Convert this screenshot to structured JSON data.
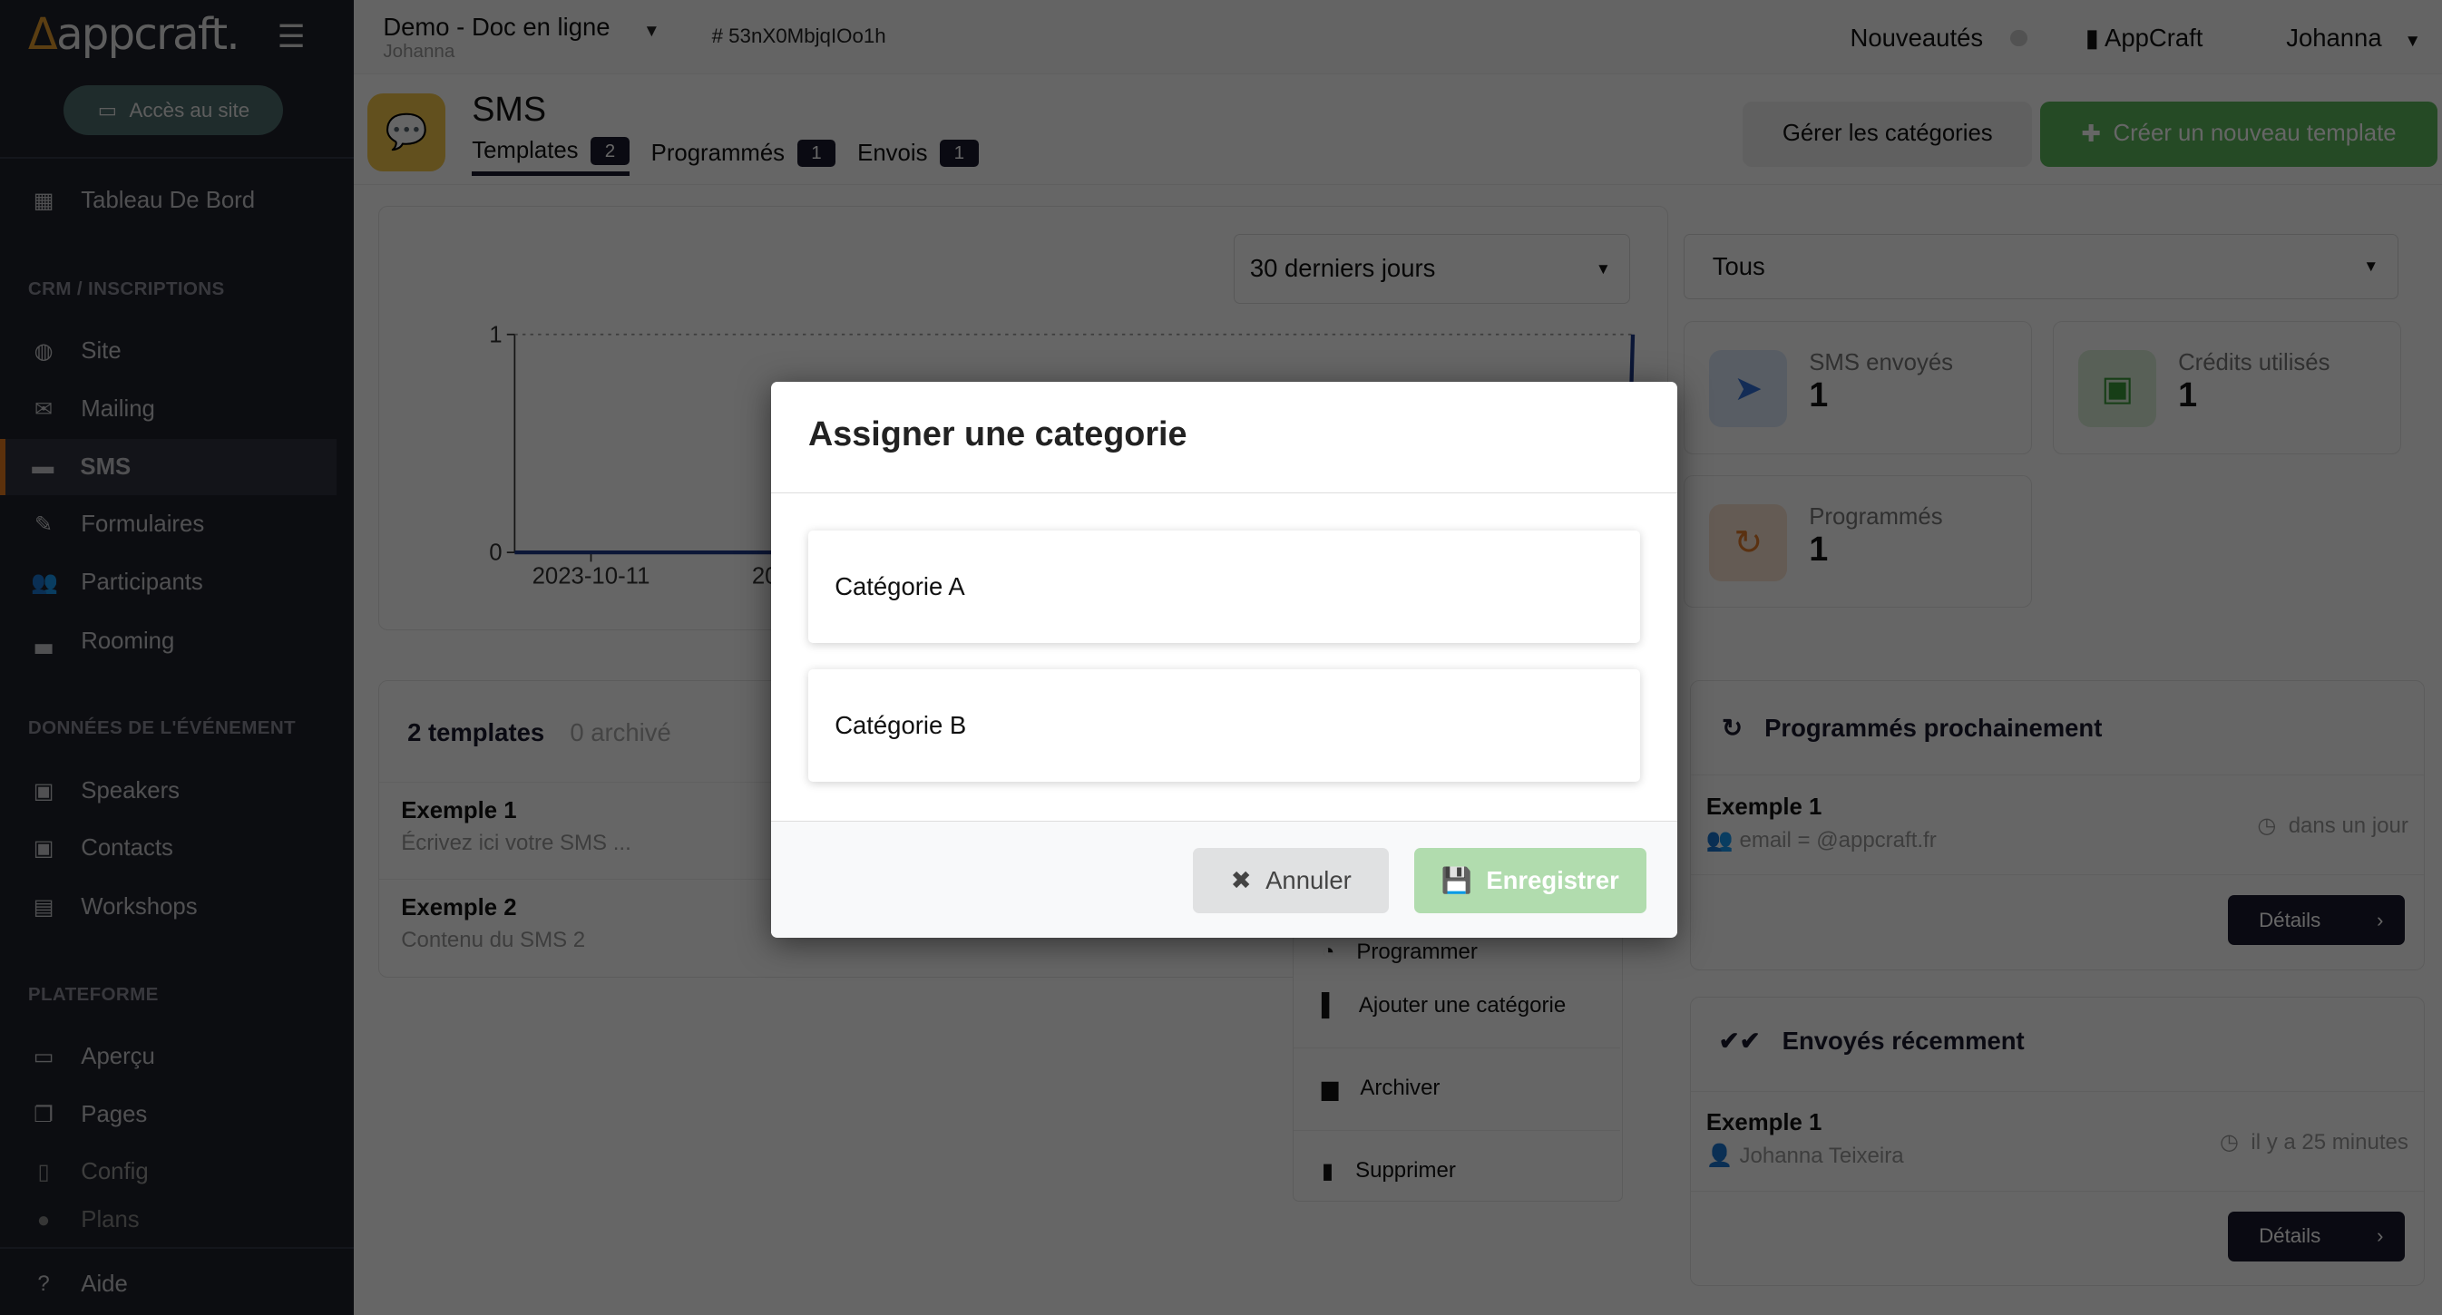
{
  "sidebar": {
    "logo": "appcraft.",
    "site_button": "Accès au site",
    "dashboard": "Tableau De Bord",
    "sections": [
      {
        "title": "CRM / INSCRIPTIONS",
        "items": [
          "Site",
          "Mailing",
          "SMS",
          "Formulaires",
          "Participants",
          "Rooming"
        ]
      },
      {
        "title": "DONNÉES DE L'ÉVÉNEMENT",
        "items": [
          "Speakers",
          "Contacts",
          "Workshops"
        ]
      },
      {
        "title": "PLATEFORME",
        "items": [
          "Aperçu",
          "Pages",
          "Config",
          "Plans"
        ]
      }
    ],
    "help": "Aide",
    "active": "SMS",
    "accent": "#e67a1f"
  },
  "topbar": {
    "project": "Demo - Doc en ligne",
    "owner": "Johanna",
    "hash": "# 53nX0MbjqIOo1h",
    "news": "Nouveautés",
    "org": "AppCraft",
    "user": "Johanna"
  },
  "page": {
    "title": "SMS",
    "tabs": [
      {
        "label": "Templates",
        "count": "2"
      },
      {
        "label": "Programmés",
        "count": "1"
      },
      {
        "label": "Envois",
        "count": "1"
      }
    ],
    "manage_categories": "Gérer les catégories",
    "create_template": "Créer un nouveau template"
  },
  "chart_filter": "30 derniers jours",
  "chart_data": {
    "type": "line",
    "x": [
      "2023-10-11",
      "…",
      "latest"
    ],
    "x_tick_labels": [
      "2023-10-11",
      "2023"
    ],
    "y_ticks": [
      "0",
      "1"
    ],
    "ylim": [
      0,
      1
    ],
    "series": [
      {
        "values": [
          0,
          0,
          1
        ]
      }
    ],
    "color": "#1e3a8a"
  },
  "type_filter": "Tous",
  "stats": [
    {
      "label": "SMS envoyés",
      "value": "1",
      "color": "#2f6fd6"
    },
    {
      "label": "Crédits utilisés",
      "value": "1",
      "color": "#3a9a3a"
    },
    {
      "label": "Programmés",
      "value": "1",
      "color": "#e07b2a"
    }
  ],
  "templates": {
    "count": "2 templates",
    "archived": "0 archivé",
    "rows": [
      {
        "title": "Exemple 1",
        "body": "Écrivez ici votre SMS ..."
      },
      {
        "title": "Exemple 2",
        "body": "Contenu du SMS 2"
      }
    ]
  },
  "context_menu": [
    "Programmer",
    "Ajouter une catégorie",
    "Archiver",
    "Supprimer"
  ],
  "scheduled": {
    "title": "Programmés prochainement",
    "item": {
      "title": "Exemple 1",
      "target": "email = @appcraft.fr",
      "when": "dans un jour"
    },
    "details": "Détails"
  },
  "recent": {
    "title": "Envoyés récemment",
    "item": {
      "title": "Exemple 1",
      "target": "Johanna Teixeira",
      "when": "il y a 25 minutes"
    },
    "details": "Détails"
  },
  "modal": {
    "title": "Assigner une categorie",
    "options": [
      "Catégorie A",
      "Catégorie B"
    ],
    "cancel": "Annuler",
    "save": "Enregistrer"
  }
}
